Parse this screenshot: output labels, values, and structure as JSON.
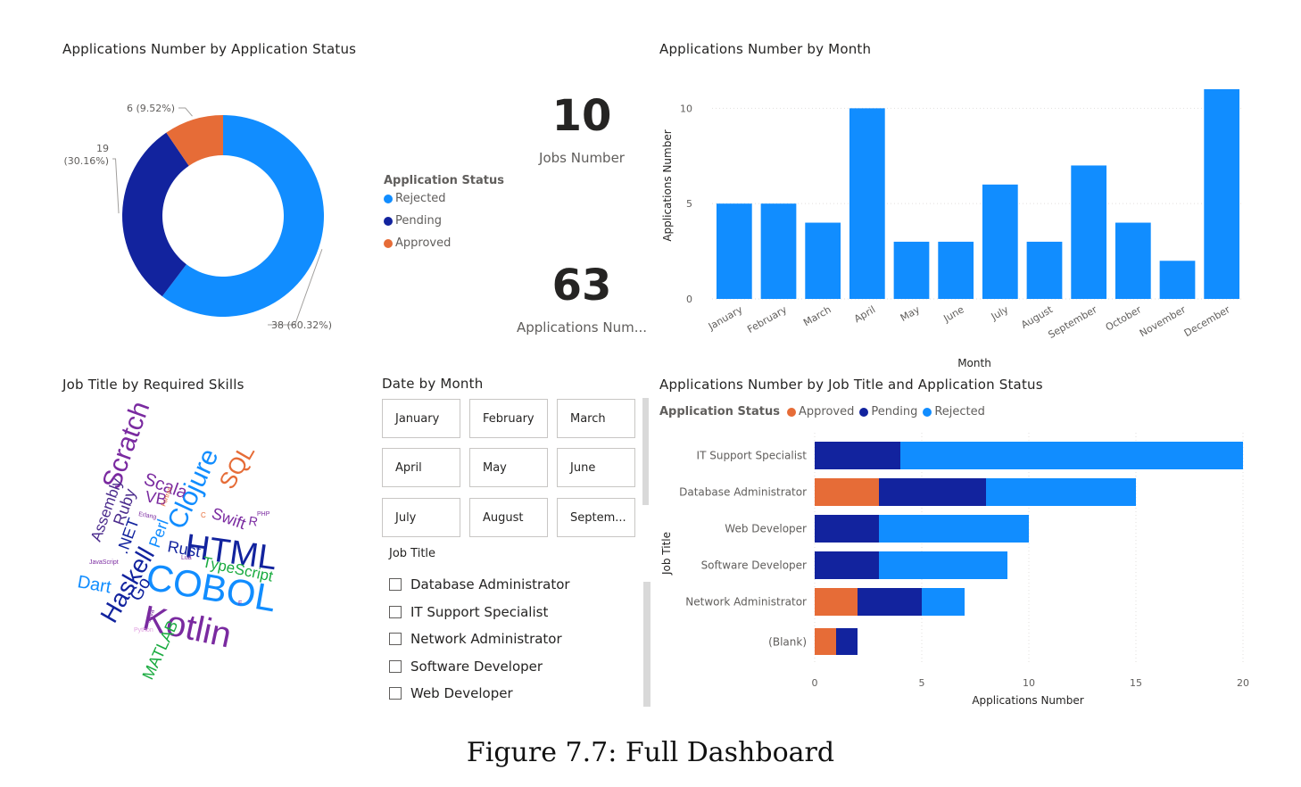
{
  "colors": {
    "rejected": "#118DFF",
    "pending": "#12239E",
    "approved": "#E66C37",
    "grid": "#e1dfdd",
    "axis": "#605e5c"
  },
  "donut": {
    "title": "Applications Number by Application Status",
    "legend_title": "Application Status",
    "legend": [
      "Rejected",
      "Pending",
      "Approved"
    ]
  },
  "kpi": {
    "jobs": {
      "value": "10",
      "label": "Jobs Number"
    },
    "apps": {
      "value": "63",
      "label": "Applications Num..."
    }
  },
  "month_chart": {
    "title": "Applications Number by Month"
  },
  "wordcloud": {
    "title": "Job Title by Required Skills",
    "words": [
      {
        "text": "Scratch",
        "color": "#7a2aa0",
        "icon": "word"
      },
      {
        "text": "Scala",
        "color": "#7a2aa0"
      },
      {
        "text": "SQL",
        "color": "#e66c37"
      },
      {
        "text": "Clojure",
        "color": "#118dff"
      },
      {
        "text": "VB",
        "color": "#7a2aa0"
      },
      {
        "text": "Assembly",
        "color": "#4a2a8c"
      },
      {
        "text": "Ruby",
        "color": "#4a2a8c"
      },
      {
        "text": "Swift",
        "color": "#7a2aa0"
      },
      {
        "text": "R",
        "color": "#7a2aa0"
      },
      {
        "text": "PHP",
        "color": "#7a2aa0"
      },
      {
        "text": "C",
        "color": "#e66c37"
      },
      {
        "text": "Erlang",
        "color": "#7a2aa0"
      },
      {
        "text": "Fortran",
        "color": "#e66c37"
      },
      {
        "text": "Perl",
        "color": "#118dff"
      },
      {
        "text": ".NET",
        "color": "#12239e"
      },
      {
        "text": "HTML",
        "color": "#12239e"
      },
      {
        "text": "Rust",
        "color": "#12239e"
      },
      {
        "text": "TypeScript",
        "color": "#1aab40"
      },
      {
        "text": "Lua",
        "color": "#7a2aa0"
      },
      {
        "text": "JavaScript",
        "color": "#7a2aa0"
      },
      {
        "text": "COBOL",
        "color": "#118dff"
      },
      {
        "text": "Haskell",
        "color": "#12239e"
      },
      {
        "text": "Dart",
        "color": "#118dff"
      },
      {
        "text": "Go",
        "color": "#12239e"
      },
      {
        "text": "Kotlin",
        "color": "#7a2aa0"
      },
      {
        "text": "F",
        "color": "#7a2aa0"
      },
      {
        "text": "Java",
        "color": "#7a2aa0"
      },
      {
        "text": "MATLAB",
        "color": "#1aab40"
      },
      {
        "text": "Python",
        "color": "#e0a0e0"
      }
    ]
  },
  "date_slicer": {
    "title": "Date by Month",
    "months": [
      "January",
      "February",
      "March",
      "April",
      "May",
      "June",
      "July",
      "August",
      "Septem..."
    ]
  },
  "job_slicer": {
    "title": "Job Title",
    "items": [
      "Database Administrator",
      "IT Support Specialist",
      "Network Administrator",
      "Software Developer",
      "Web Developer"
    ]
  },
  "job_chart": {
    "title": "Applications Number by Job Title and Application Status",
    "legend_title": "Application Status",
    "legend": [
      "Approved",
      "Pending",
      "Rejected"
    ]
  },
  "caption": "Figure 7.7: Full Dashboard",
  "chart_data": [
    {
      "type": "pie",
      "title": "Applications Number by Application Status",
      "categories": [
        "Rejected",
        "Pending",
        "Approved"
      ],
      "values": [
        38,
        19,
        6
      ],
      "labels": [
        "38 (60.32%)",
        "19 (30.16%)",
        "6 (9.52%)"
      ],
      "legend": "left-middle",
      "hole": true
    },
    {
      "type": "bar",
      "title": "Applications Number by Month",
      "categories": [
        "January",
        "February",
        "March",
        "April",
        "May",
        "June",
        "July",
        "August",
        "September",
        "October",
        "November",
        "December"
      ],
      "values": [
        5,
        5,
        4,
        10,
        3,
        3,
        6,
        3,
        7,
        4,
        2,
        11
      ],
      "xlabel": "Month",
      "ylabel": "Applications Number",
      "ylim": [
        0,
        11
      ],
      "yticks": [
        0,
        5,
        10
      ],
      "grid": true
    },
    {
      "type": "bar",
      "orientation": "horizontal",
      "stacked": true,
      "title": "Applications Number by Job Title and Application Status",
      "categories": [
        "IT Support Specialist",
        "Database Administrator",
        "Web Developer",
        "Software Developer",
        "Network Administrator",
        "(Blank)"
      ],
      "series": [
        {
          "name": "Approved",
          "values": [
            0,
            3,
            0,
            0,
            2,
            1
          ]
        },
        {
          "name": "Pending",
          "values": [
            4,
            5,
            3,
            3,
            3,
            1
          ]
        },
        {
          "name": "Rejected",
          "values": [
            16,
            7,
            7,
            6,
            2,
            0
          ]
        }
      ],
      "xlabel": "Applications Number",
      "ylabel": "Job Title",
      "xlim": [
        0,
        20
      ],
      "xticks": [
        0,
        5,
        10,
        15,
        20
      ],
      "grid": true,
      "legend": "top-left"
    }
  ]
}
